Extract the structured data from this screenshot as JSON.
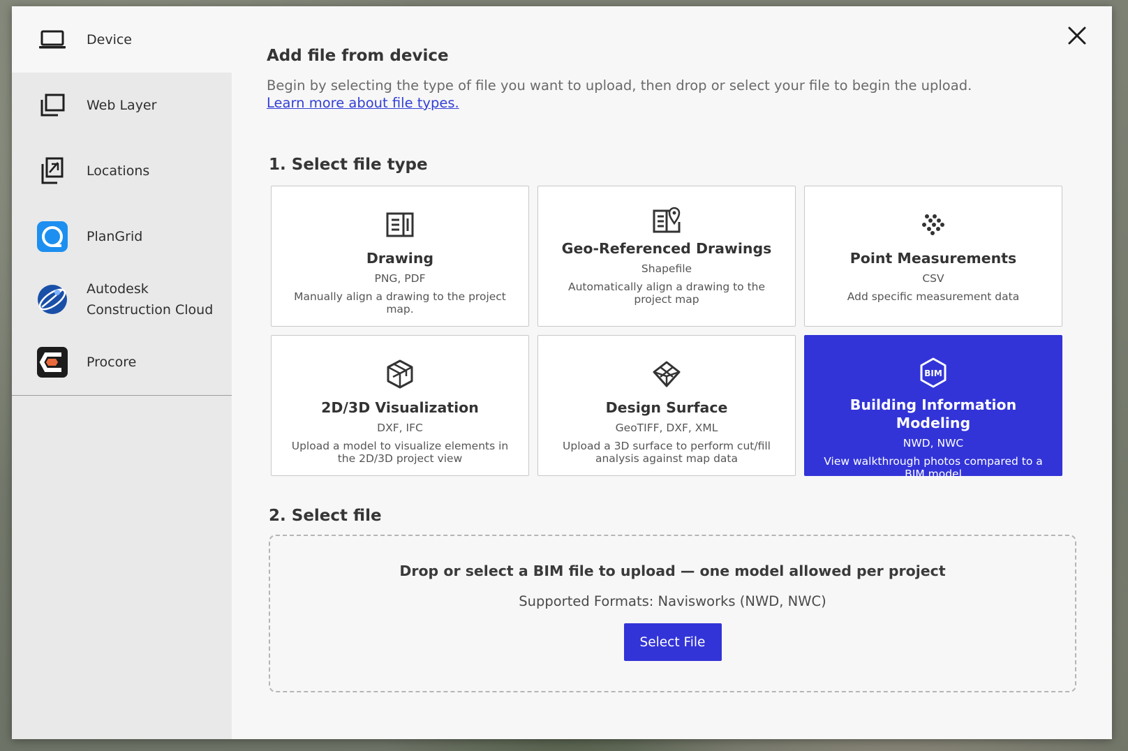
{
  "sidebar": {
    "items": [
      {
        "label": "Device",
        "icon": "laptop-icon"
      },
      {
        "label": "Web Layer",
        "icon": "layers-icon"
      },
      {
        "label": "Locations",
        "icon": "locations-icon"
      },
      {
        "label": "PlanGrid",
        "icon": "plangrid-logo-icon"
      },
      {
        "label": "Autodesk Construction Cloud",
        "icon": "autodesk-logo-icon"
      },
      {
        "label": "Procore",
        "icon": "procore-logo-icon"
      }
    ]
  },
  "header": {
    "title": "Add file from device",
    "description": "Begin by selecting the type of file you want to upload, then drop or select your file to begin the upload.",
    "learn_link": "Learn more about file types."
  },
  "step1": {
    "title": "1. Select file type",
    "cards": [
      {
        "title": "Drawing",
        "formats": "PNG, PDF",
        "description": "Manually align a drawing to the project map.",
        "icon": "drawing-icon"
      },
      {
        "title": "Geo-Referenced Drawings",
        "formats": "Shapefile",
        "description": "Automatically align a drawing to the project map",
        "icon": "geo-drawing-icon"
      },
      {
        "title": "Point Measurements",
        "formats": "CSV",
        "description": "Add specific measurement data",
        "icon": "points-icon"
      },
      {
        "title": "2D/3D Visualization",
        "formats": "DXF, IFC",
        "description": "Upload a model to visualize elements in the 2D/3D project view",
        "icon": "cube-icon"
      },
      {
        "title": "Design Surface",
        "formats": "GeoTIFF, DXF, XML",
        "description": "Upload a 3D surface to perform cut/fill analysis against map data",
        "icon": "surface-icon"
      },
      {
        "title": "Building Information Modeling",
        "formats": "NWD, NWC",
        "description": "View walkthrough photos compared to a BIM model",
        "icon": "bim-icon",
        "icon_text": "BIM"
      }
    ],
    "selected": "Building Information Modeling"
  },
  "step2": {
    "title": "2. Select file",
    "drop_text": "Drop or select a BIM file to upload — one model allowed per project",
    "formats_text": "Supported Formats: Navisworks (NWD, NWC)",
    "button_label": "Select File"
  },
  "colors": {
    "accent": "#3234d8",
    "sidebar_bg": "#e9e9e9",
    "modal_bg": "#f7f7f7"
  }
}
